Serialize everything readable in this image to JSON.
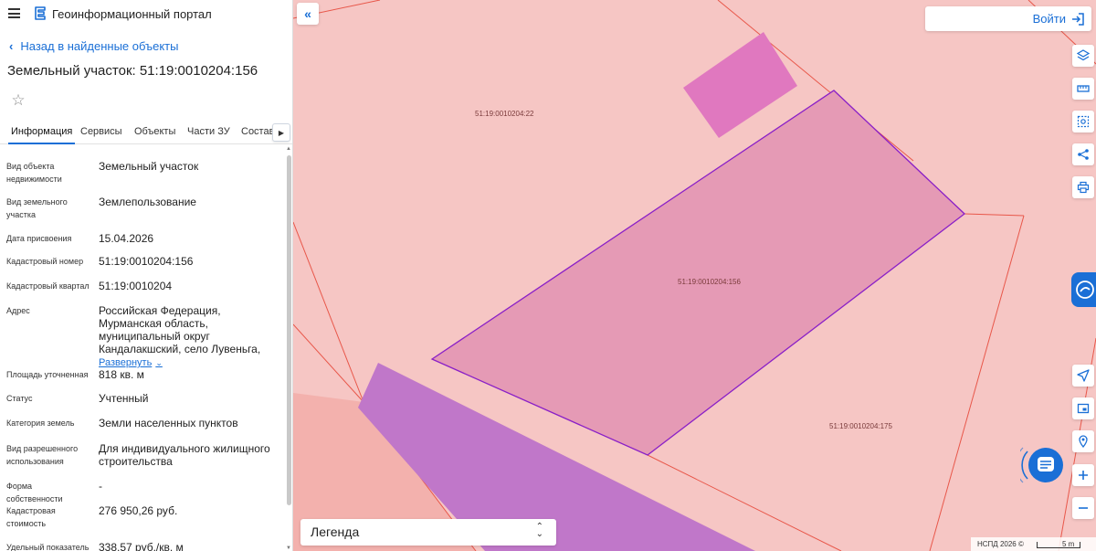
{
  "header": {
    "app_title": "Геоинформационный портал",
    "menu_icon": "hamburger-icon",
    "logo_icon": "portal-logo-icon"
  },
  "panel": {
    "back_label": "Назад в найденные объекты",
    "object_title": "Земельный участок: 51:19:0010204:156",
    "favorite_icon": "star-icon",
    "tabs": [
      {
        "label": "Информация",
        "active": true
      },
      {
        "label": "Сервисы",
        "active": false
      },
      {
        "label": "Объекты",
        "active": false
      },
      {
        "label": "Части ЗУ",
        "active": false
      },
      {
        "label": "Состав",
        "active": false
      }
    ],
    "properties": [
      {
        "label": "Вид объекта недвижимости",
        "value": "Земельный участок"
      },
      {
        "label": "Вид земельного участка",
        "value": "Землепользование"
      },
      {
        "label": "Дата присвоения",
        "value": "15.04.2026"
      },
      {
        "label": "Кадастровый номер",
        "value": "51:19:0010204:156"
      },
      {
        "label": "Кадастровый квартал",
        "value": "51:19:0010204"
      },
      {
        "label": "Адрес",
        "value": "Российская Федерация, Мурманская область, муниципальный округ Кандалакшский, село Лувеньга,",
        "expand_label": "Развернуть"
      },
      {
        "label": "Площадь уточненная",
        "value": "818 кв. м"
      },
      {
        "label": "Статус",
        "value": "Учтенный"
      },
      {
        "label": "Категория земель",
        "value": "Земли населенных пунктов"
      },
      {
        "label": "Вид разрешенного использования",
        "value": "Для индивидуального жилищного строительства"
      },
      {
        "label": "Форма собственности",
        "value": "-"
      },
      {
        "label": "Кадастровая стоимость",
        "value": "276 950,26 руб."
      },
      {
        "label": "Удельный показатель",
        "value": "338,57 руб./кв. м"
      }
    ]
  },
  "map": {
    "login_label": "Войти",
    "parcel_labels": {
      "north": "51:19:0010204:22",
      "selected": "51:19:0010204:156",
      "east": "51:19:0010204:175"
    },
    "legend_label": "Легенда",
    "copyright": "НСПД 2026 ©",
    "scale_label": "5 m",
    "tools": [
      "layers-icon",
      "ruler-icon",
      "select-area-icon",
      "share-icon",
      "print-icon",
      "location-icon",
      "minimap-icon",
      "geo-pin-icon",
      "zoom-in-icon",
      "zoom-out-icon"
    ],
    "colors": {
      "background": "#f6c6c4",
      "selected_parcel": "#e59ab5",
      "selected_border": "#8a1fc7",
      "building": "#e078bf",
      "road": "#c077c9",
      "boundary": "#e8574a",
      "accent": "#1a6fd6"
    }
  }
}
